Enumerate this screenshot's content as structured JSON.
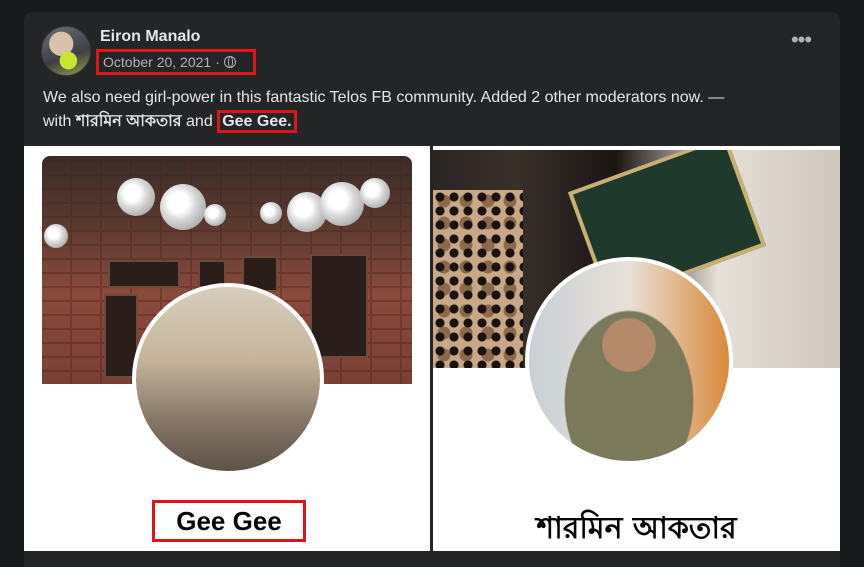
{
  "post": {
    "author": "Eiron Manalo",
    "date": "October 20, 2021",
    "separator": "·",
    "privacy_icon": "globe-icon",
    "more_icon": "more-options-icon",
    "text_main": "We also need girl-power in this fantastic Telos FB community. Added 2 other moderators now. —",
    "text_with": "with",
    "tag1": "শারমিন আকতার",
    "text_and": "and",
    "tag2": "Gee Gee."
  },
  "photos": {
    "left_name": "Gee Gee",
    "right_name": "শারমিন আকতার"
  },
  "colors": {
    "card_bg": "#242526",
    "page_bg": "#18191a",
    "highlight_box": "#e0141b",
    "text_primary": "#e4e6eb",
    "text_secondary": "#b0b3b8"
  }
}
